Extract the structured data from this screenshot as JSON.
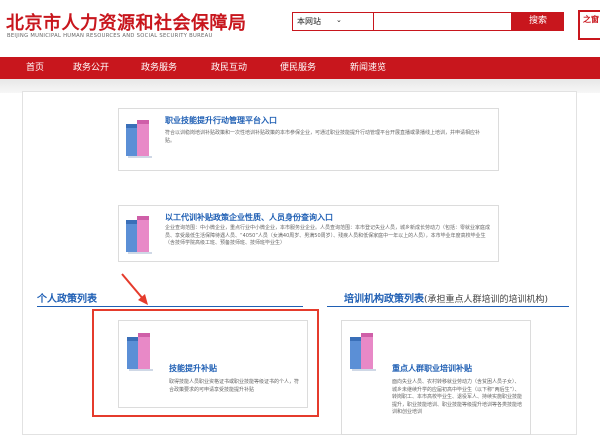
{
  "header": {
    "logo_cn": "北京市人力资源和社会保障局",
    "logo_en": "BEIJING MUNICIPAL HUMAN RESOURCES AND SOCIAL SECURITY BUREAU",
    "search_scope": "本网站",
    "search_placeholder": "",
    "search_button": "搜索",
    "seal_text": "之窗"
  },
  "nav": {
    "items": [
      {
        "label": "首页"
      },
      {
        "label": "政务公开"
      },
      {
        "label": "政务服务"
      },
      {
        "label": "政民互动"
      },
      {
        "label": "便民服务"
      },
      {
        "label": "新闻速览"
      }
    ]
  },
  "cards": [
    {
      "title": "职业技能提升行动管理平台入口",
      "desc": "符合以训稳岗培训补贴政策和一次性培训补贴政策的本市参保企业，可通过职业技能提升行动管理平台开展直播或录播线上培训，并申请相应补贴。"
    },
    {
      "title": "以工代训补贴政策企业性质、人员身份查询入口",
      "desc": "企业查询范围：中小微企业，重点行业中小微企业，本市服务业企业。人员查询范围：本市登记失业人员，城乡新成长劳动力（包括：零就业家庭成员、享受最低生活保障待遇人员、“4050”人员（女满40周岁、男满50周岁）、残疾人员和低保家庭中一年以上的人员），本市毕业年度高校毕业生（含技师学院高级工班、预备技师班、技师班毕业生）"
    }
  ],
  "sections": {
    "personal": {
      "title": "个人政策列表"
    },
    "institution": {
      "title": "培训机构政策列表",
      "subtitle": "(承担重点人群培训的培训机构)"
    }
  },
  "policy_cards": [
    {
      "title": "技能提升补贴",
      "desc": "取得技能人员职业资格证书或职业技能等级证书的个人，符合政策要求的可申请享受技能提升补贴"
    },
    {
      "title": "重点人群职业培训补贴",
      "desc": "面向失业人员、农村转移就业劳动力（含贫困人员子女）、城乡未继续升学的应届初高中毕业生（以下称“两后生”）、转岗职工、本市高校毕业生、退役军人、持续实施职业技能提升，职业技能培训、职业技能等级提升培训等各类技能培训和创业培训"
    }
  ],
  "colors": {
    "brand_red": "#c8161d",
    "link_blue": "#1f5fb4",
    "highlight_red": "#e53b2c"
  }
}
